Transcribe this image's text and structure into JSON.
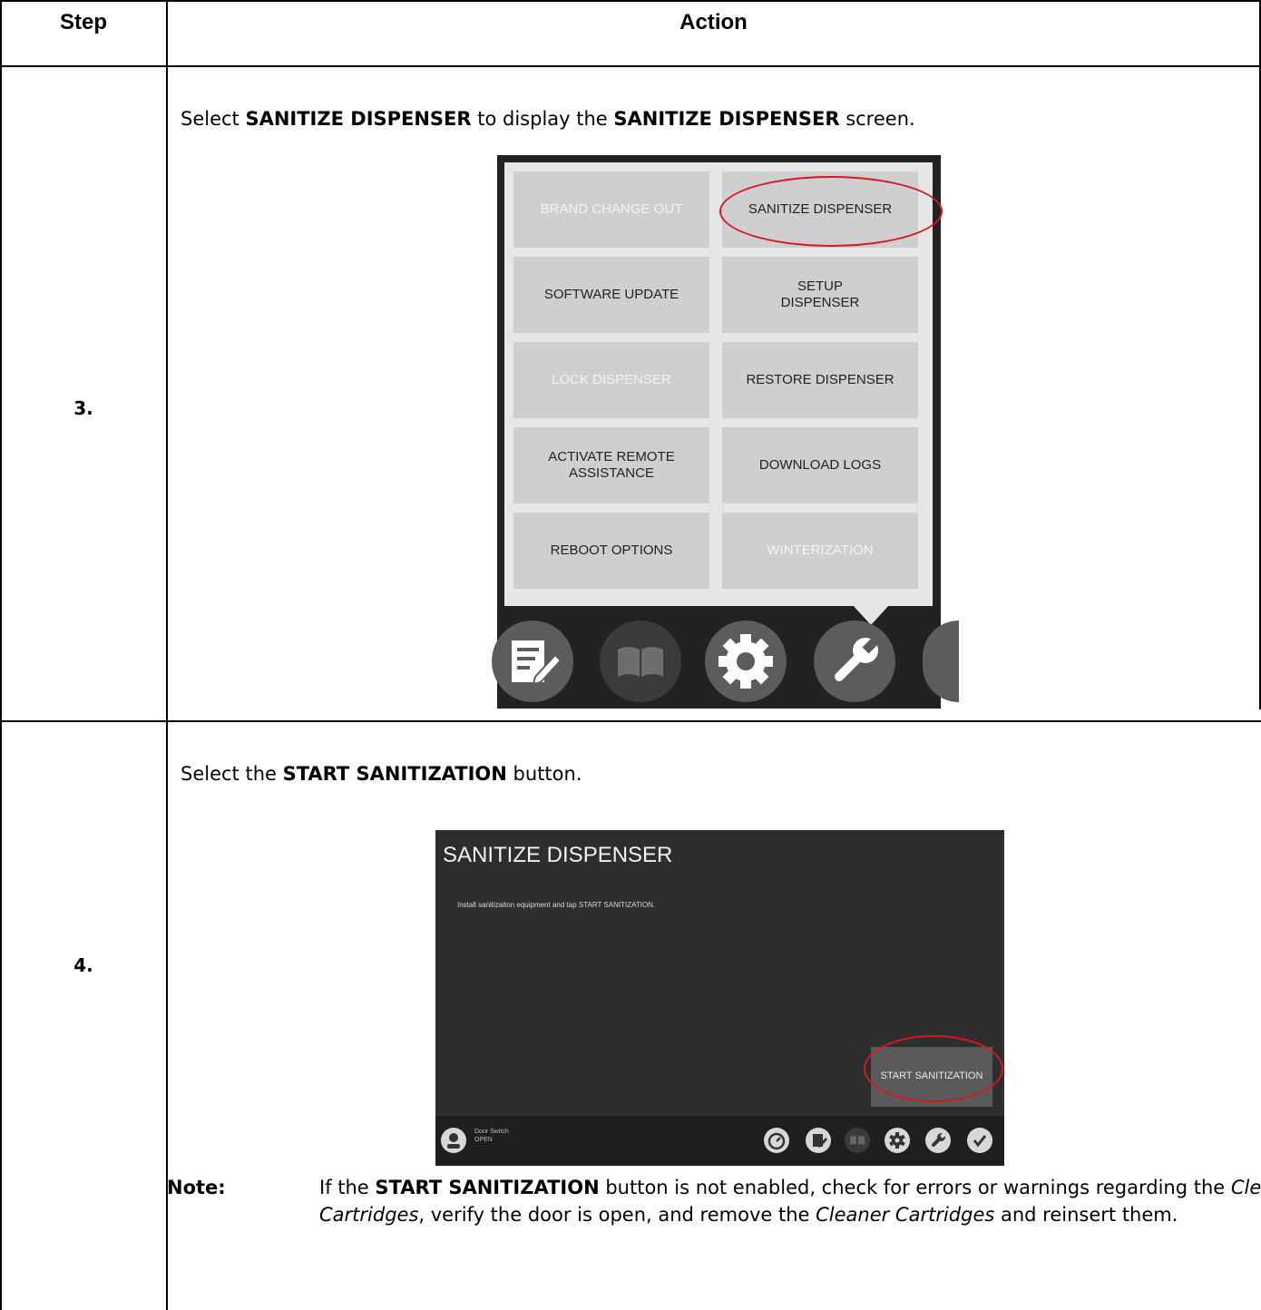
{
  "table": {
    "header_step": "Step",
    "header_action": "Action"
  },
  "rows": [
    {
      "step": "3.",
      "instruction": {
        "t1": "Select ",
        "b1": "SANITIZE DISPENSER",
        "t2": " to display the ",
        "b2": "SANITIZE DISPENSER",
        "t3": " screen."
      },
      "menu": {
        "buttons": [
          {
            "label": "BRAND CHANGE OUT",
            "state": "disabled"
          },
          {
            "label": "SANITIZE DISPENSER",
            "state": "enabled"
          },
          {
            "label": "SOFTWARE UPDATE",
            "state": "enabled"
          },
          {
            "label": "SETUP DISPENSER",
            "state": "enabled"
          },
          {
            "label": "LOCK DISPENSER",
            "state": "disabled"
          },
          {
            "label": "RESTORE DISPENSER",
            "state": "enabled"
          },
          {
            "label": "ACTIVATE REMOTE ASSISTANCE",
            "state": "enabled"
          },
          {
            "label": "DOWNLOAD LOGS",
            "state": "enabled"
          },
          {
            "label": "REBOOT OPTIONS",
            "state": "enabled"
          },
          {
            "label": "WINTERIZATION",
            "state": "disabled"
          }
        ],
        "toolbar_icons": [
          "edit-icon",
          "book-icon",
          "gear-icon",
          "wrench-icon"
        ],
        "highlighted": "SANITIZE DISPENSER"
      }
    },
    {
      "step": "4.",
      "instruction": {
        "t1": "Select the ",
        "b1": "START SANITIZATION",
        "t2": " button."
      },
      "screen": {
        "title": "SANITIZE DISPENSER",
        "message": "Install sanitizaiton equipment and tap START SANITIZATION.",
        "start_button": "START SANITIZATION",
        "door_label": "Door Switch",
        "door_status": "OPEN",
        "toolbar_icons": [
          "timer-icon",
          "edit-icon",
          "book-icon",
          "gear-icon",
          "wrench-icon",
          "check-icon"
        ]
      },
      "note": {
        "label": "Note:",
        "t1": "If the ",
        "b1": "START SANITIZATION",
        "t2": " button is not enabled, check for errors or warnings regarding the ",
        "i1": "Cleaner Cartridges",
        "t3": ", verify the door is open, and remove the ",
        "i2": "Cleaner Cartridges",
        "t4": " and reinsert them."
      }
    }
  ],
  "colors": {
    "highlight_ring": "#d9181e",
    "menu_bg": "#222222",
    "button_bg": "#cfcfcf",
    "screen_bg": "#2e2e2e"
  }
}
